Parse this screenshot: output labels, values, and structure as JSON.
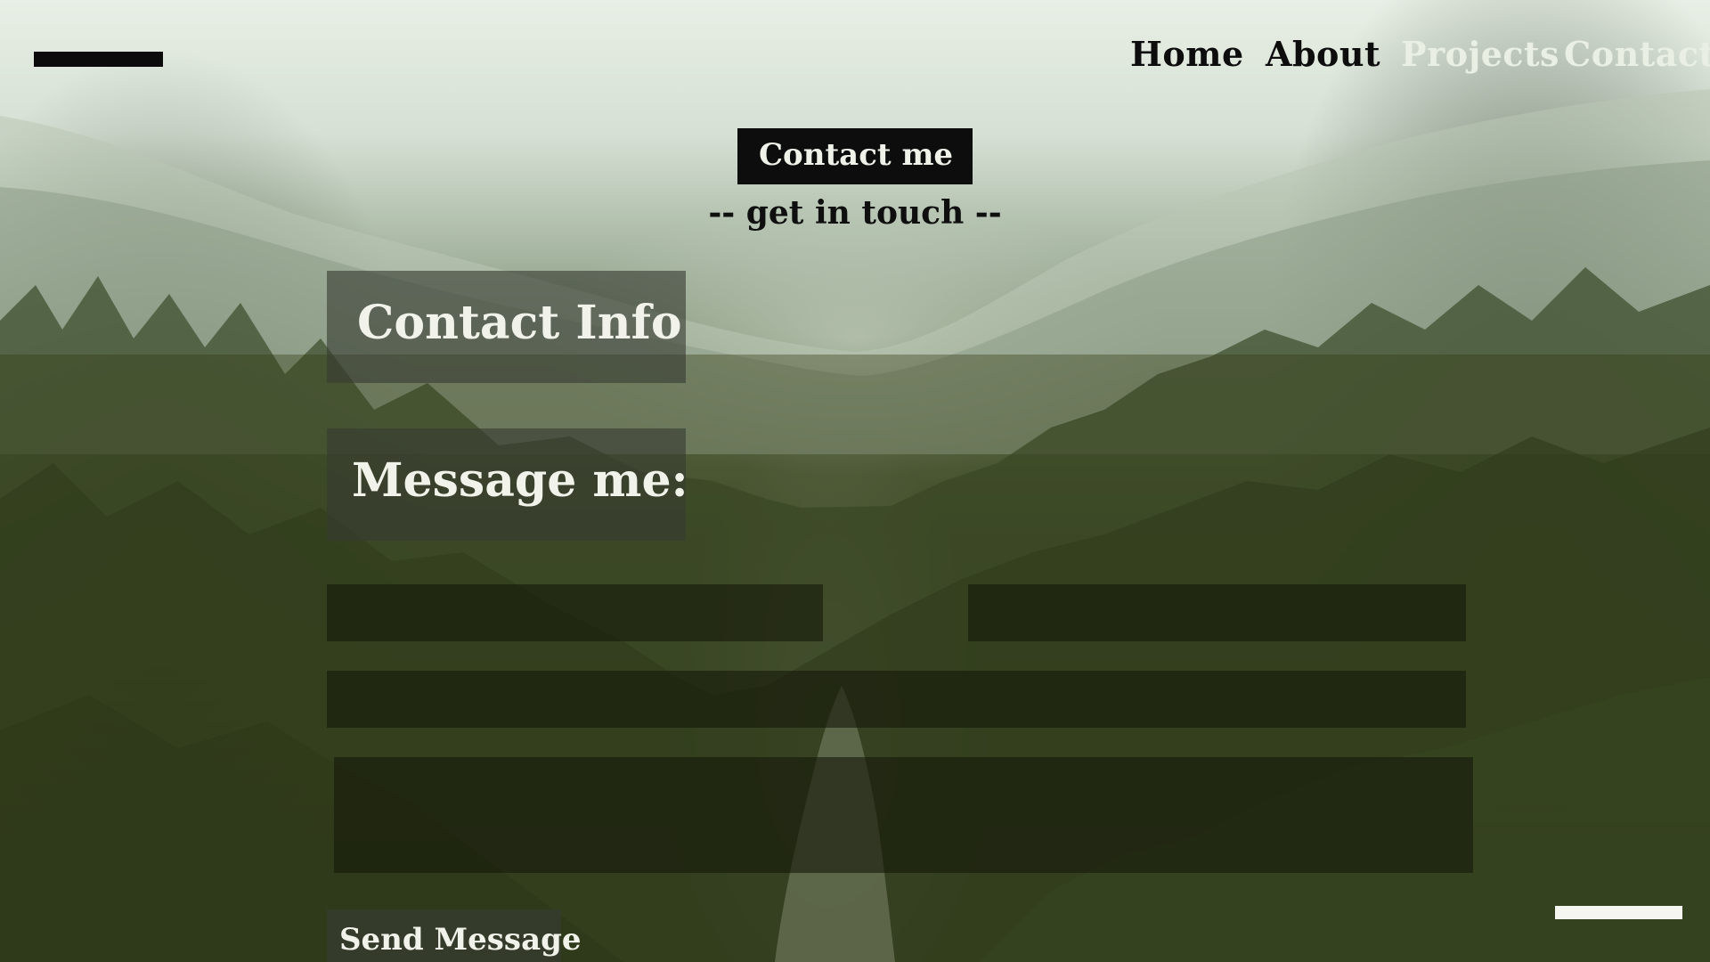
{
  "nav": {
    "items": [
      {
        "label": "Home"
      },
      {
        "label": "About"
      },
      {
        "label": "Projects"
      },
      {
        "label": "Contact"
      }
    ]
  },
  "hero": {
    "title": "Contact me",
    "subtitle": "-- get in touch --"
  },
  "contact_info": {
    "heading": "Contact Info"
  },
  "message": {
    "heading": "Message me:"
  },
  "form": {
    "name_value": "",
    "email_value": "",
    "subject_value": "",
    "message_value": "",
    "send_label": "Send Message"
  },
  "colors": {
    "nav_text": "#0d0d0d",
    "nav_text_light": "#e9efe2",
    "hero_box": "#0d0d0d",
    "panel_text": "#f1f3ea",
    "scroll_indicator": "#f5f6ef"
  }
}
